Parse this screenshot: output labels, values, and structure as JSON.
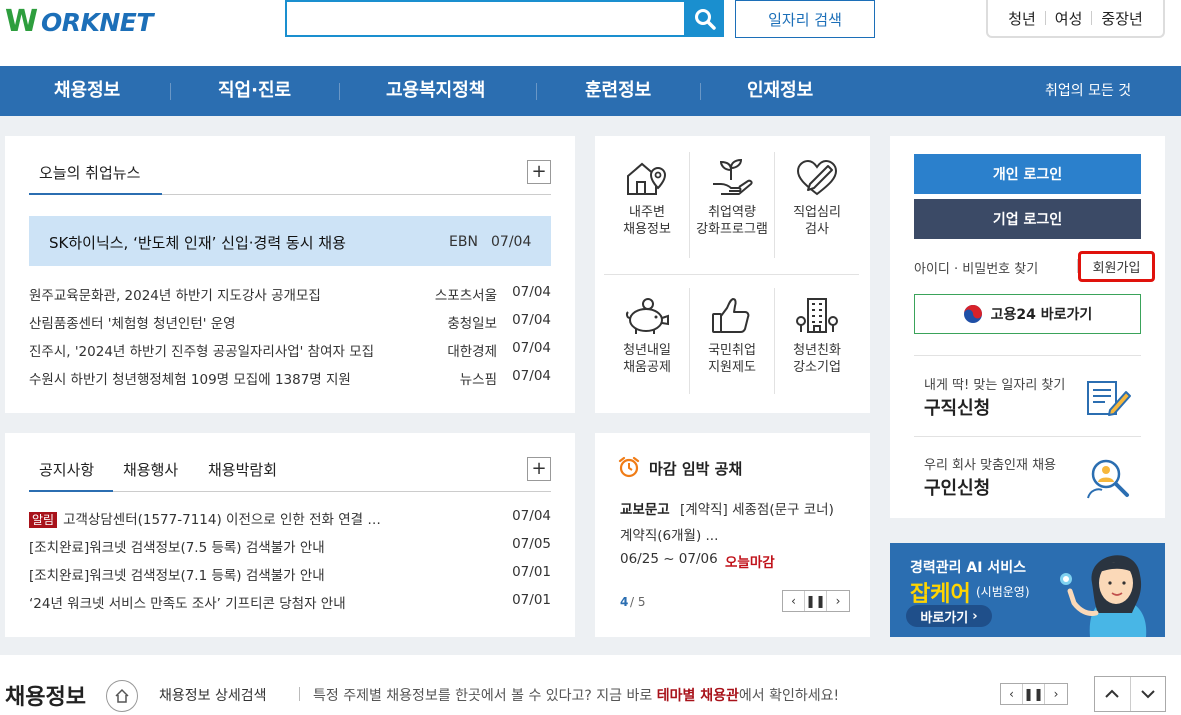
{
  "header": {
    "logo_w": "W",
    "logo_rest": "ORKNET",
    "search_placeholder": "",
    "job_search_label": "일자리 검색",
    "targets": [
      "청년",
      "여성",
      "중장년"
    ]
  },
  "nav": {
    "items": [
      "채용정보",
      "직업·진로",
      "고용복지정책",
      "훈련정보",
      "인재정보"
    ],
    "all_label": "취업의 모든 것"
  },
  "news": {
    "tab_label": "오늘의 취업뉴스",
    "headline": {
      "title": "SK하이닉스, ‘반도체 인재’ 신입·경력 동시 채용",
      "source": "EBN",
      "date": "07/04"
    },
    "items": [
      {
        "title": "원주교육문화관, 2024년 하반기 지도강사 공개모집",
        "source": "스포츠서울",
        "date": "07/04"
      },
      {
        "title": "산림품종센터 '체험형 청년인턴' 운영",
        "source": "충청일보",
        "date": "07/04"
      },
      {
        "title": "진주시, '2024년 하반기 진주형 공공일자리사업' 참여자 모집",
        "source": "대한경제",
        "date": "07/04"
      },
      {
        "title": "수원시 하반기 청년행정체험 109명 모집에 1387명 지원",
        "source": "뉴스핌",
        "date": "07/04"
      }
    ]
  },
  "quick_menu": [
    {
      "icon": "house-location-icon",
      "line1": "내주변",
      "line2": "채용정보"
    },
    {
      "icon": "hand-sprout-icon",
      "line1": "취업역량",
      "line2": "강화프로그램"
    },
    {
      "icon": "heart-pen-icon",
      "line1": "직업심리",
      "line2": "검사"
    },
    {
      "icon": "piggy-bank-icon",
      "line1": "청년내일",
      "line2": "채움공제"
    },
    {
      "icon": "thumbs-up-icon",
      "line1": "국민취업",
      "line2": "지원제도"
    },
    {
      "icon": "building-icon",
      "line1": "청년친화",
      "line2": "강소기업"
    }
  ],
  "login": {
    "personal_label": "개인 로그인",
    "company_label": "기업 로그인",
    "find_label": "아이디 · 비밀번호 찾기",
    "signup_label": "회원가입",
    "goyong24_label": "고용24 바로가기",
    "job_seek": {
      "sub": "내게 딱! 맞는 일자리 찾기",
      "title": "구직신청"
    },
    "recruit": {
      "sub": "우리 회사 맞춤인재 채용",
      "title": "구인신청"
    }
  },
  "notice": {
    "tabs": [
      "공지사항",
      "채용행사",
      "채용박람회"
    ],
    "badge": "알림",
    "items": [
      {
        "title": "고객상담센터(1577-7114) 이전으로 인한 전화 연결 …",
        "date": "07/04"
      },
      {
        "title": "[조치완료]워크넷 검색정보(7.5 등록) 검색불가 안내",
        "date": "07/05"
      },
      {
        "title": "[조치완료]워크넷 검색정보(7.1 등록) 검색불가 안내",
        "date": "07/01"
      },
      {
        "title": "‘24년 워크넷 서비스 만족도 조사’ 기프티콘 당첨자 안내",
        "date": "07/01"
      }
    ]
  },
  "deadline": {
    "title": "마감 임박 공채",
    "company": "교보문고",
    "desc1": "[계약직] 세종점(문구 코너)",
    "desc2": "계약직(6개월) ...",
    "period": "06/25 ~ 07/06",
    "status": "오늘마감",
    "page_current": "4",
    "page_total": "/ 5"
  },
  "banner": {
    "line1": "경력관리 AI 서비스",
    "brand": "잡케어",
    "pilot": "(시범운영)",
    "cta": "바로가기"
  },
  "bottom": {
    "title": "채용정보",
    "detail_search": "채용정보 상세검색",
    "msg_pre": "특정 주제별 채용정보를 한곳에서 볼 수 있다고? 지금 바로 ",
    "msg_highlight": "테마별 채용관",
    "msg_post": "에서 확인하세요!"
  },
  "colors": {
    "brand_blue": "#2b6eb1",
    "accent_red": "#e0120c",
    "badge_red": "#a8121a",
    "headline_bg": "#cde3f6"
  }
}
